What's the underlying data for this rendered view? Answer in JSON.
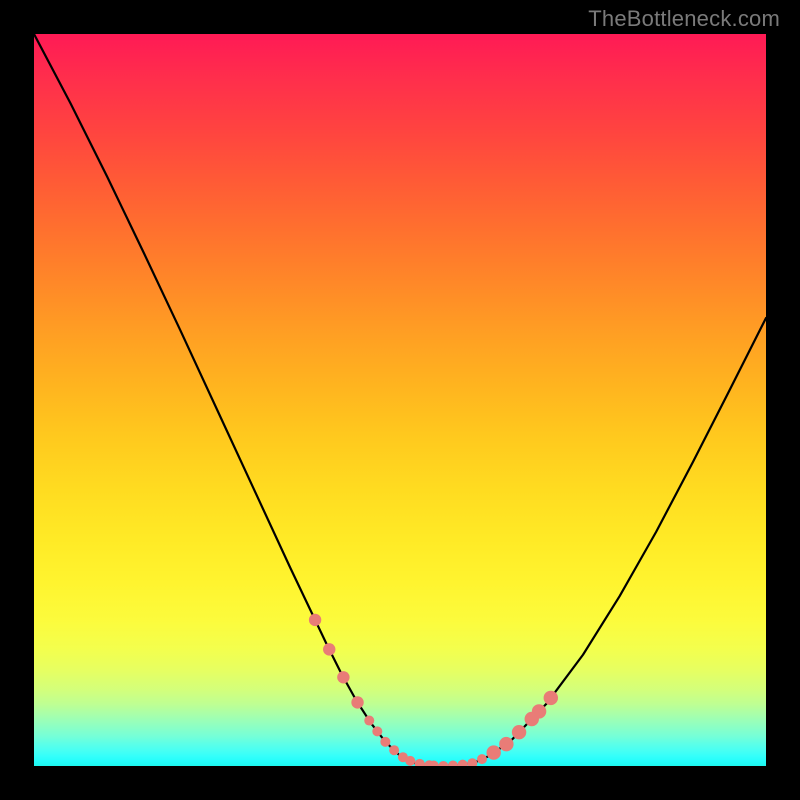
{
  "watermark": "TheBottleneck.com",
  "chart_data": {
    "type": "line",
    "title": "",
    "xlabel": "",
    "ylabel": "",
    "xlim": [
      0,
      1
    ],
    "ylim": [
      0,
      1
    ],
    "x": [
      0.0,
      0.05,
      0.1,
      0.15,
      0.2,
      0.25,
      0.3,
      0.35,
      0.4,
      0.42,
      0.44,
      0.46,
      0.48,
      0.5,
      0.52,
      0.54,
      0.56,
      0.58,
      0.6,
      0.62,
      0.65,
      0.7,
      0.75,
      0.8,
      0.85,
      0.9,
      0.95,
      1.0
    ],
    "values": [
      1.0,
      0.905,
      0.805,
      0.701,
      0.595,
      0.487,
      0.379,
      0.271,
      0.166,
      0.126,
      0.09,
      0.059,
      0.033,
      0.014,
      0.004,
      0.001,
      0.0,
      0.001,
      0.004,
      0.013,
      0.033,
      0.085,
      0.152,
      0.232,
      0.32,
      0.415,
      0.513,
      0.612
    ],
    "annotations": {
      "dotted_segments_x": [
        [
          0.384,
          0.442
        ],
        [
          0.458,
          0.48
        ],
        [
          0.492,
          0.504
        ],
        [
          0.514,
          0.54
        ],
        [
          0.546,
          0.612
        ],
        [
          0.628,
          0.68
        ],
        [
          0.69,
          0.706
        ]
      ],
      "dot_color": "#e97c77"
    }
  }
}
